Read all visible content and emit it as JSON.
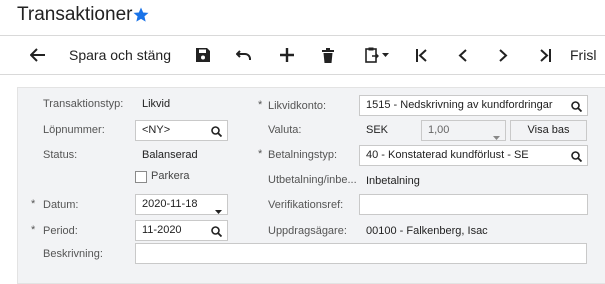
{
  "page": {
    "title": "Transaktioner"
  },
  "toolbar": {
    "save_close_label": "Spara och stäng",
    "overflow_label": "Frisl"
  },
  "form": {
    "transaktionstyp": {
      "label": "Transaktionstyp:",
      "value": "Likvid"
    },
    "lopnummer": {
      "label": "Löpnummer:",
      "value": "<NY>"
    },
    "status": {
      "label": "Status:",
      "value": "Balanserad"
    },
    "parkera": {
      "label": "Parkera",
      "checked": false
    },
    "datum": {
      "label": "Datum:",
      "value": "2020-11-18"
    },
    "period": {
      "label": "Period:",
      "value": "11-2020"
    },
    "beskrivning": {
      "label": "Beskrivning:",
      "value": ""
    },
    "likvidkonto": {
      "label": "Likvidkonto:",
      "value": "1515 - Nedskrivning av kundfordringar"
    },
    "valuta": {
      "label": "Valuta:",
      "currency": "SEK",
      "rate": "1,00",
      "button": "Visa bas"
    },
    "betalningstyp": {
      "label": "Betalningstyp:",
      "value": "40 - Konstaterad kundförlust - SE"
    },
    "utbetalning": {
      "label": "Utbetalning/inbe...",
      "value": "Inbetalning"
    },
    "verifikationsref": {
      "label": "Verifikationsref:",
      "value": ""
    },
    "uppdragsagare": {
      "label": "Uppdragsägare:",
      "value": "00100 - Falkenberg, Isac"
    }
  },
  "icons": {
    "favorite": "star-icon",
    "back": "back-arrow-icon",
    "save": "save-icon",
    "undo": "undo-icon",
    "add": "plus-icon",
    "delete": "trash-icon",
    "copy_paste": "clipboard-icon",
    "first": "first-page-icon",
    "prev": "chevron-left-icon",
    "next": "chevron-right-icon",
    "last": "last-page-icon",
    "lookup": "search-icon",
    "dropdown": "caret-down-icon"
  },
  "colors": {
    "accent": "#1a73e8",
    "panel_bg": "#f2f3f5"
  }
}
